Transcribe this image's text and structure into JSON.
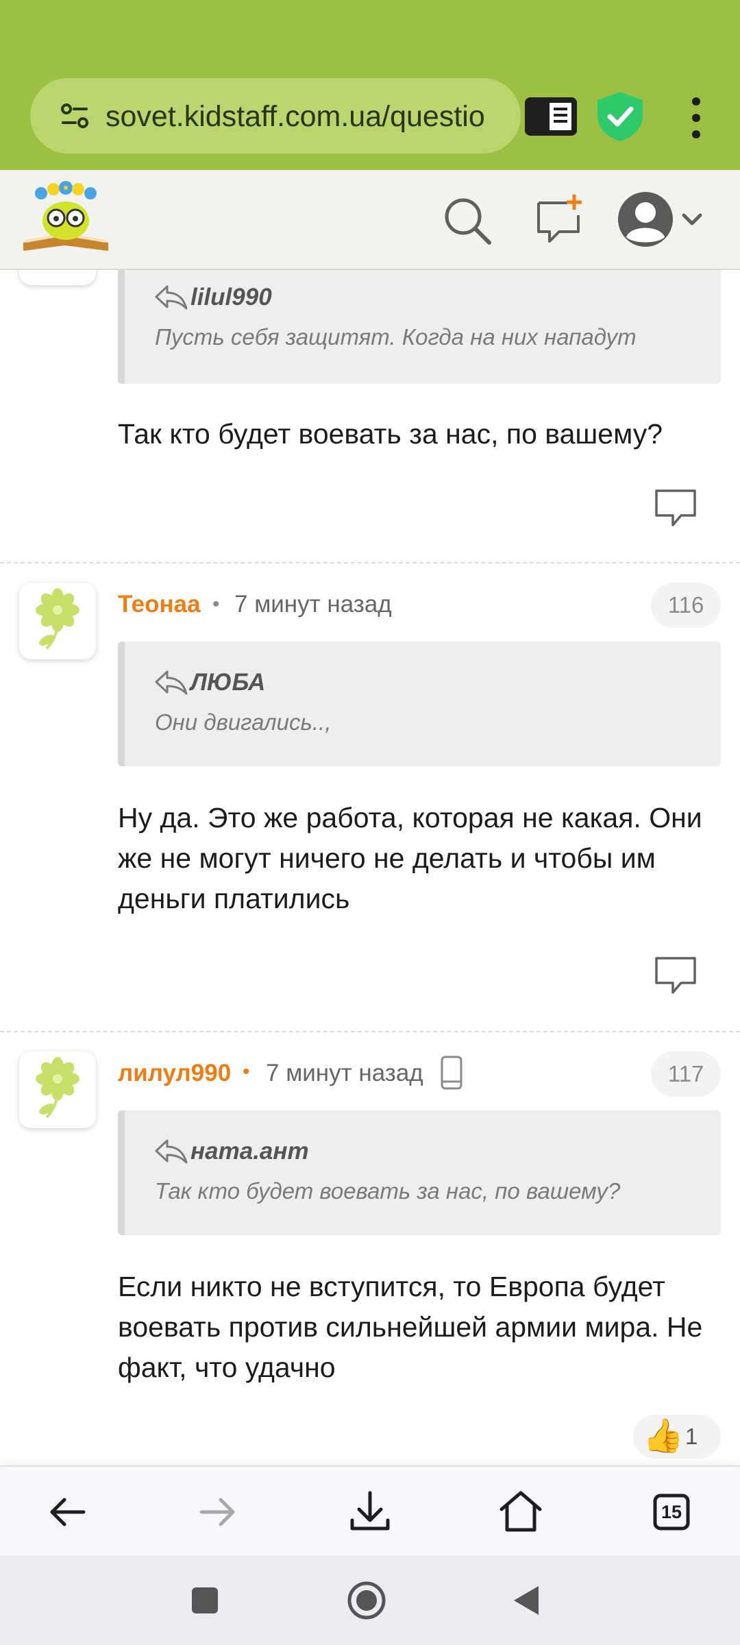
{
  "browser": {
    "url": "sovet.kidstaff.com.ua/questio"
  },
  "comments": [
    {
      "quote_author": "lilul990",
      "quote_text": "Пусть себя защитят. Когда на них нападут",
      "body": "Так кто будет воевать за нас, по вашему?"
    },
    {
      "user": "Теонаа",
      "dot": "•",
      "time": "7 минут назад",
      "number": "116",
      "quote_author": "ЛЮБА",
      "quote_text": "Они двигались..,",
      "body": "Ну да. Это же работа, которая не какая. Они же не могут ничего не делать и чтобы им деньги платились"
    },
    {
      "user": "лилул990",
      "dot": "•",
      "time": "7 минут назад",
      "number": "117",
      "quote_author": "ната.ант",
      "quote_text": "Так кто будет воевать за нас, по вашему?",
      "body": "Если никто не вступится, то Европа будет воевать против сильнейшей армии мира. Не факт, что удачно",
      "like_emoji": "👍",
      "likes": "1"
    }
  ],
  "bottom_nav": {
    "tabs_count": "15"
  },
  "colors": {
    "browser_bar": "#9bc043",
    "username": "#ee7d16",
    "shield": "#2dc96b"
  }
}
